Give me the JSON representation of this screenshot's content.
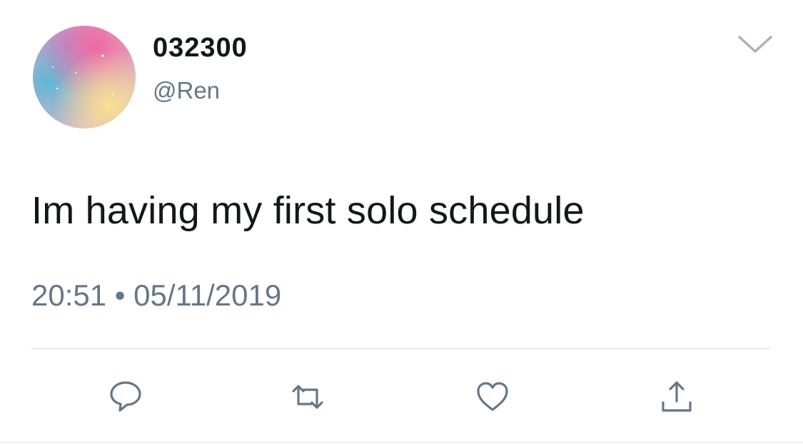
{
  "tweet": {
    "display_name": "032300",
    "handle": "@Ren",
    "text": "Im having my first solo schedule",
    "timestamp": "20:51 • 05/11/2019"
  },
  "icons": {
    "menu": "chevron-down-icon",
    "reply": "reply-bubble-icon",
    "retweet": "retweet-icon",
    "like": "heart-icon",
    "share": "share-upload-icon"
  },
  "colors": {
    "text_primary": "#14171a",
    "text_secondary": "#657786",
    "icon": "#657786",
    "divider": "#d8dde1"
  }
}
